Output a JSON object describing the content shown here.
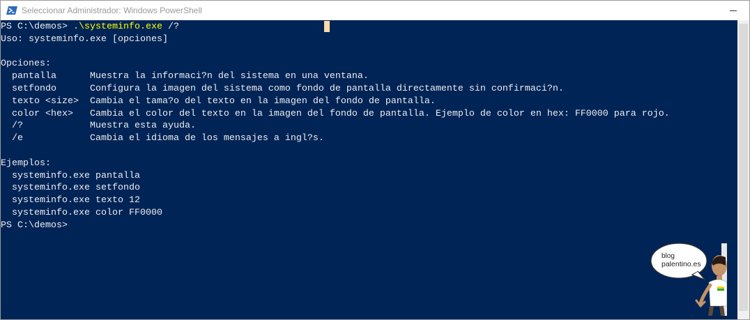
{
  "window": {
    "title": "Seleccionar Administrador: Windows PowerShell"
  },
  "console": {
    "prompt1": "PS C:\\demos> ",
    "command": ".\\systeminfo.exe",
    "args": " /?",
    "output_lines": [
      "Uso: systeminfo.exe [opciones]",
      "",
      "Opciones:",
      "  pantalla      Muestra la informaci?n del sistema en una ventana.",
      "  setfondo      Configura la imagen del sistema como fondo de pantalla directamente sin confirmaci?n.",
      "  texto <size>  Cambia el tama?o del texto en la imagen del fondo de pantalla.",
      "  color <hex>   Cambia el color del texto en la imagen del fondo de pantalla. Ejemplo de color en hex: FF0000 para rojo.",
      "  /?            Muestra esta ayuda.",
      "  /e            Cambia el idioma de los mensajes a ingl?s.",
      "",
      "Ejemplos:",
      "  systeminfo.exe pantalla",
      "  systeminfo.exe setfondo",
      "  systeminfo.exe texto 12",
      "  systeminfo.exe color FF0000"
    ],
    "prompt2": "PS C:\\demos>"
  },
  "logo": {
    "line1": "blog",
    "line2": "palentino.es"
  },
  "colors": {
    "console_bg": "#012456",
    "console_fg": "#eeedf0",
    "command_fg": "#ffff00",
    "cursor": "#fedba9"
  },
  "icons": {
    "app": "powershell-icon",
    "minimize": "minimize-icon"
  }
}
